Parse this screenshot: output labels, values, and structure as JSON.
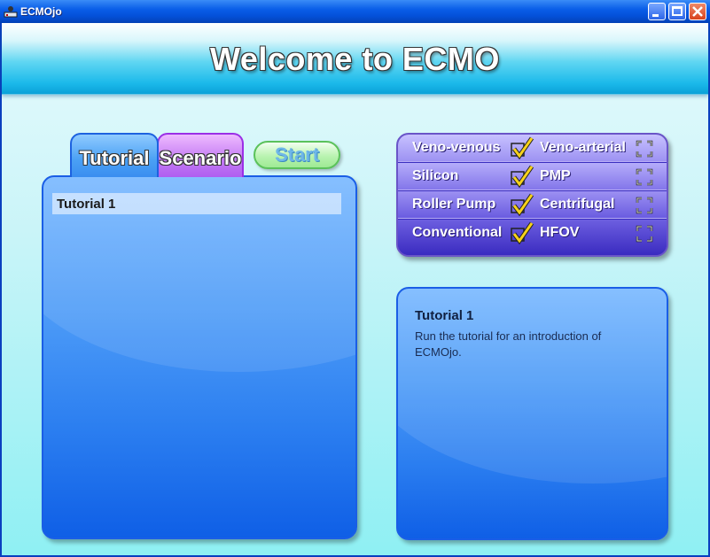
{
  "window": {
    "title": "ECMOjo"
  },
  "banner": {
    "title": "Welcome to ECMO"
  },
  "tabs": [
    {
      "label": "Tutorial",
      "active": true
    },
    {
      "label": "Scenario",
      "active": false
    }
  ],
  "start_button": {
    "label": "Start"
  },
  "list": {
    "items": [
      {
        "label": "Tutorial 1",
        "selected": true
      }
    ]
  },
  "options": {
    "rows": [
      {
        "left": "Veno-venous",
        "left_checked": true,
        "right": "Veno-arterial",
        "right_checked": false
      },
      {
        "left": "Silicon",
        "left_checked": true,
        "right": "PMP",
        "right_checked": false
      },
      {
        "left": "Roller Pump",
        "left_checked": true,
        "right": "Centrifugal",
        "right_checked": false
      },
      {
        "left": "Conventional",
        "left_checked": true,
        "right": "HFOV",
        "right_checked": false
      }
    ]
  },
  "description": {
    "title": "Tutorial 1",
    "body": "Run the tutorial for an introduction of ECMOjo."
  },
  "colors": {
    "titlebar": "#0a5ee8",
    "panel_blue": "#2b7ef0",
    "tab_tutorial": "#4aa0f4",
    "tab_scenario": "#c37af3",
    "start_green": "#b9f3b0",
    "options_purple": "#6a5ce0",
    "checkmark_yellow": "#f7d21a"
  }
}
